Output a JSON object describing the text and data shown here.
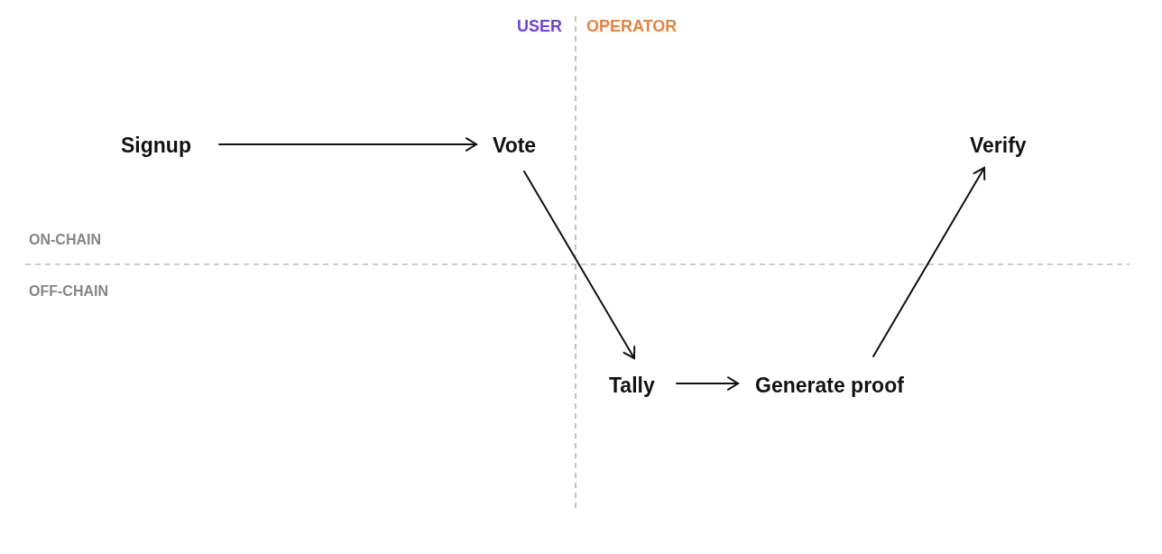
{
  "columns": [
    {
      "label": "USER",
      "color": "#6c44e0"
    },
    {
      "label": "OPERATOR",
      "color": "#e8823e"
    }
  ],
  "regions": [
    "ON-CHAIN",
    "OFF-CHAIN"
  ],
  "steps": [
    "Signup",
    "Vote",
    "Verify",
    "Tally",
    "Generate proof"
  ]
}
